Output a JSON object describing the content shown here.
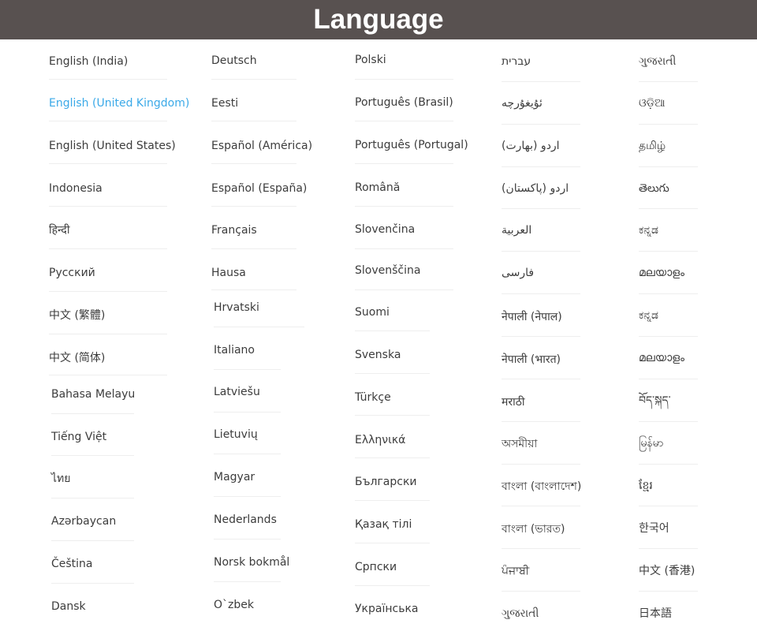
{
  "header": {
    "title": "Language"
  },
  "colors": {
    "header_bg": "#585150",
    "text": "#3c3c3c",
    "selected": "#3aa9e8"
  },
  "columns": [
    {
      "items": [
        {
          "label": "English (India)"
        },
        {
          "label": "English (United Kingdom)",
          "selected": true
        },
        {
          "label": "English (United States)"
        },
        {
          "label": "Indonesia"
        },
        {
          "label": "हिन्दी"
        },
        {
          "label": "Русский"
        },
        {
          "label": "中文 (繁體)"
        },
        {
          "label": "中文 (简体)"
        },
        {
          "label": "Bahasa Melayu"
        },
        {
          "label": "Tiếng Việt"
        },
        {
          "label": "ไทย"
        },
        {
          "label": "Azərbaycan"
        },
        {
          "label": "Čeština"
        },
        {
          "label": "Dansk"
        }
      ]
    },
    {
      "items": [
        {
          "label": "Deutsch"
        },
        {
          "label": "Eesti"
        },
        {
          "label": "Español (América)"
        },
        {
          "label": "Español (España)"
        },
        {
          "label": "Français"
        },
        {
          "label": "Hausa"
        },
        {
          "label": "Hrvatski"
        },
        {
          "label": "Italiano"
        },
        {
          "label": "Latviešu"
        },
        {
          "label": "Lietuvių"
        },
        {
          "label": "Magyar"
        },
        {
          "label": "Nederlands"
        },
        {
          "label": "Norsk bokmål"
        },
        {
          "label": "O`zbek"
        }
      ]
    },
    {
      "items": [
        {
          "label": "Polski"
        },
        {
          "label": "Português (Brasil)"
        },
        {
          "label": "Português (Portugal)"
        },
        {
          "label": "Română"
        },
        {
          "label": "Slovenčina"
        },
        {
          "label": "Slovenščina"
        },
        {
          "label": "Suomi"
        },
        {
          "label": "Svenska"
        },
        {
          "label": "Türkçe"
        },
        {
          "label": "Ελληνικά"
        },
        {
          "label": "Български"
        },
        {
          "label": "Қазақ тілі"
        },
        {
          "label": "Српски"
        },
        {
          "label": "Українська"
        }
      ]
    },
    {
      "items": [
        {
          "label": "עברית"
        },
        {
          "label": "ئۇيغۇرچە"
        },
        {
          "label": "اردو (بھارت)"
        },
        {
          "label": "اردو (پاکستان)"
        },
        {
          "label": "العربية"
        },
        {
          "label": "فارسی"
        },
        {
          "label": "नेपाली (नेपाल)"
        },
        {
          "label": "नेपाली (भारत)"
        },
        {
          "label": "मराठी"
        },
        {
          "label": "অসমীয়া"
        },
        {
          "label": "বাংলা (বাংলাদেশ)"
        },
        {
          "label": "বাংলা (ভারত)"
        },
        {
          "label": "ਪੰਜਾਬੀ"
        },
        {
          "label": "ગુજરાતી"
        }
      ]
    },
    {
      "items": [
        {
          "label": "ગુજરાતી"
        },
        {
          "label": "ଓଡ଼ିଆ"
        },
        {
          "label": "தமிழ்"
        },
        {
          "label": "తెలుగు"
        },
        {
          "label": "ಕನ್ನಡ"
        },
        {
          "label": "മലയാളം"
        },
        {
          "label": "ಕನ್ನಡ"
        },
        {
          "label": "മലയാളം"
        },
        {
          "label": "བོད་སྐད་"
        },
        {
          "label": "မြန်မာ"
        },
        {
          "label": "ខ្មែរ"
        },
        {
          "label": "한국어"
        },
        {
          "label": "中文 (香港)"
        },
        {
          "label": "日本語"
        }
      ]
    }
  ]
}
